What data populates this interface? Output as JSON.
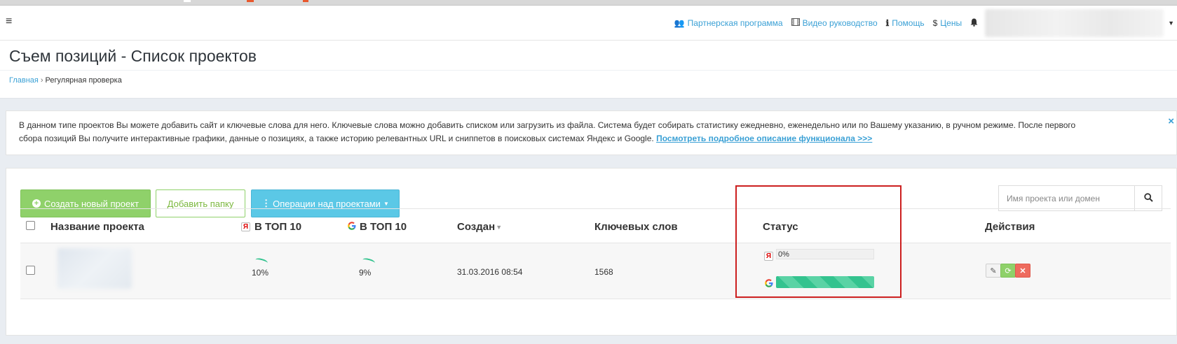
{
  "topbar": {
    "partner_label": "Партнерская программа",
    "video_label": "Видео руководство",
    "help_label": "Помощь",
    "prices_label": "Цены"
  },
  "page": {
    "title": "Съем позиций - Список проектов",
    "breadcrumb_home": "Главная",
    "breadcrumb_separator": "›",
    "breadcrumb_current": "Регулярная проверка"
  },
  "info": {
    "text": "В данном типе проектов Вы можете добавить сайт и ключевые слова для него. Ключевые слова можно добавить списком или загрузить из файла. Система будет собирать статистику ежедневно, еженедельно или по Вашему указанию, в ручном режиме. После первого сбора позиций Вы получите интерактивные графики, данные о позициях, а также историю релевантных URL и сниппетов в поисковых системах Яндекс и Google.",
    "link_text": "Посмотреть подробное описание функционала >>>",
    "close_glyph": "×"
  },
  "toolbar": {
    "create_label": "Создать новый проект",
    "folder_label": "Добавить папку",
    "ops_label": "Операции над проектами",
    "search_placeholder": "Имя проекта или домен"
  },
  "table": {
    "columns": {
      "name": "Название проекта",
      "yandex_top": "В ТОП 10",
      "google_top": "В ТОП 10",
      "created": "Создан",
      "keywords": "Ключевых слов",
      "status": "Статус",
      "actions": "Действия"
    },
    "rows": [
      {
        "yandex_top": "10%",
        "google_top": "9%",
        "created": "31.03.2016 08:54",
        "keywords": "1568",
        "status_yandex_pct": "0%",
        "status_yandex_progress": 0,
        "status_google_progress": 1.0
      }
    ]
  },
  "colors": {
    "accent": "#3aa0d5",
    "success": "#8fd16a",
    "info": "#5bc8e6",
    "danger": "#ee6b5e",
    "highlight_frame": "#cc1f1f"
  }
}
